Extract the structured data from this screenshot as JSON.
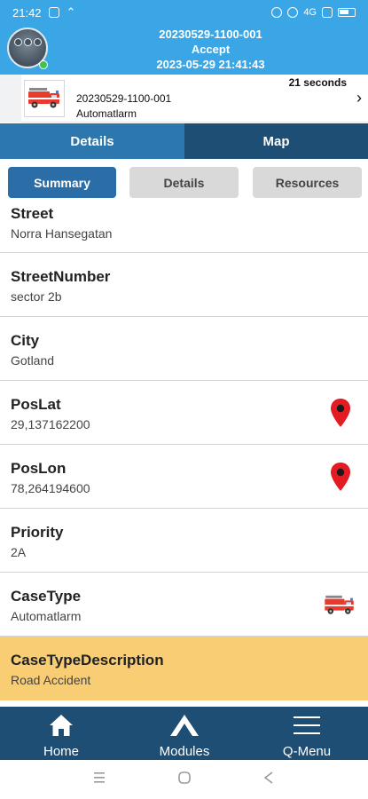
{
  "status_bar": {
    "time": "21:42",
    "network": "4G",
    "battery_icon": "battery-icon"
  },
  "header": {
    "case_id": "20230529-1100-001",
    "status": "Accept",
    "timestamp": "2023-05-29 21:41:43",
    "avatar_icon": "dispatcher-avatar-icon"
  },
  "case_row": {
    "case_id": "20230529-1100-001",
    "case_type": "Automatlarm",
    "elapsed": "21 seconds",
    "icon": "fire-truck-icon"
  },
  "main_tabs": [
    {
      "label": "Details",
      "active": true
    },
    {
      "label": "Map",
      "active": false
    }
  ],
  "sub_tabs": [
    {
      "label": "Summary",
      "active": true
    },
    {
      "label": "Details",
      "active": false
    },
    {
      "label": "Resources",
      "active": false
    }
  ],
  "fields": [
    {
      "label": "Street",
      "value": "Norra Hansegatan"
    },
    {
      "label": "StreetNumber",
      "value": "sector 2b"
    },
    {
      "label": "City",
      "value": "Gotland"
    },
    {
      "label": "PosLat",
      "value": "29,137162200",
      "icon": "map-pin-icon"
    },
    {
      "label": "PosLon",
      "value": "78,264194600",
      "icon": "map-pin-icon"
    },
    {
      "label": "Priority",
      "value": "2A"
    },
    {
      "label": "CaseType",
      "value": "Automatlarm",
      "icon": "fire-truck-icon"
    },
    {
      "label": "CaseTypeDescription",
      "value": "Road Accident",
      "highlight": true
    }
  ],
  "bottom_nav": [
    {
      "label": "Home",
      "icon": "home-icon"
    },
    {
      "label": "Modules",
      "icon": "modules-icon"
    },
    {
      "label": "Q-Menu",
      "icon": "hamburger-menu-icon"
    }
  ],
  "colors": {
    "header_bg": "#3aa6e6",
    "tab_active": "#2c77ae",
    "tab_inactive": "#1f4e75",
    "subtab_active": "#2b6da6",
    "highlight_row": "#f8cd74",
    "pin_red": "#e31b23"
  }
}
